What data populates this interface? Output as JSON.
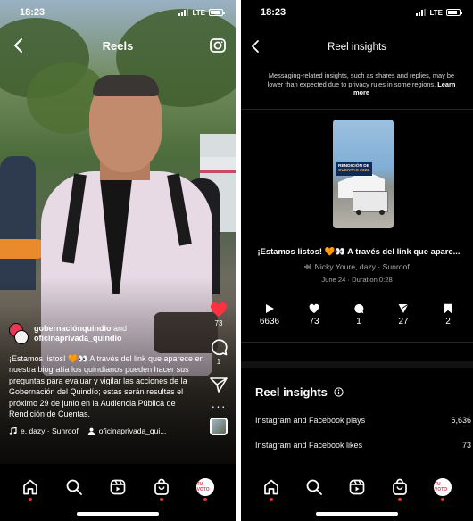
{
  "colors": {
    "background": "#000000",
    "like_red": "#ff3040",
    "muted_text": "#a8a8a8",
    "notification_dot": "#ff3040"
  },
  "reel_screen": {
    "status_bar": {
      "time": "18:23",
      "network": "LTE"
    },
    "title": "Reels",
    "owner": {
      "primary": "gobernaciónquindio",
      "connector": "and",
      "secondary": "oficinaprivada_quindio"
    },
    "caption": "¡Estamos listos! 🧡👀 A través del link que aparece en nuestra biografía los quindianos pueden hacer sus preguntas para evaluar y vigilar las acciones de la Gobernación del Quindío; estas serán resultas el próximo 29 de junio en la Audiencia Pública de Rendición de Cuentas.",
    "audio": "e, dazy · Sunroof",
    "collab": "oficinaprivada_qui...",
    "actions": {
      "likes": "73",
      "comments": "1"
    },
    "profile_label": "TU VOTO"
  },
  "insights_screen": {
    "status_bar": {
      "time": "18:23",
      "network": "LTE"
    },
    "title": "Reel insights",
    "privacy_notice": "Messaging-related insights, such as shares and replies, may be lower than expected due to privacy rules in some regions.",
    "learn_more": "Learn more",
    "thumbnail_badge": {
      "line1": "RENDICIÓN DE",
      "line2": "CUENTAS 2022"
    },
    "reel_caption": "¡Estamos listos! 🧡👀 A través del link que apare...",
    "reel_audio": "Nicky Youre, dazy · Sunroof",
    "reel_date": "June 24 · Duration 0:28",
    "metrics": {
      "plays": "6636",
      "likes": "73",
      "comments": "1",
      "shares": "27",
      "saves": "2"
    },
    "section_title": "Reel insights",
    "rows": [
      {
        "label": "Instagram and Facebook plays",
        "value": "6,636"
      },
      {
        "label": "Instagram and Facebook likes",
        "value": "73"
      }
    ],
    "profile_label": "TU VOTO"
  }
}
